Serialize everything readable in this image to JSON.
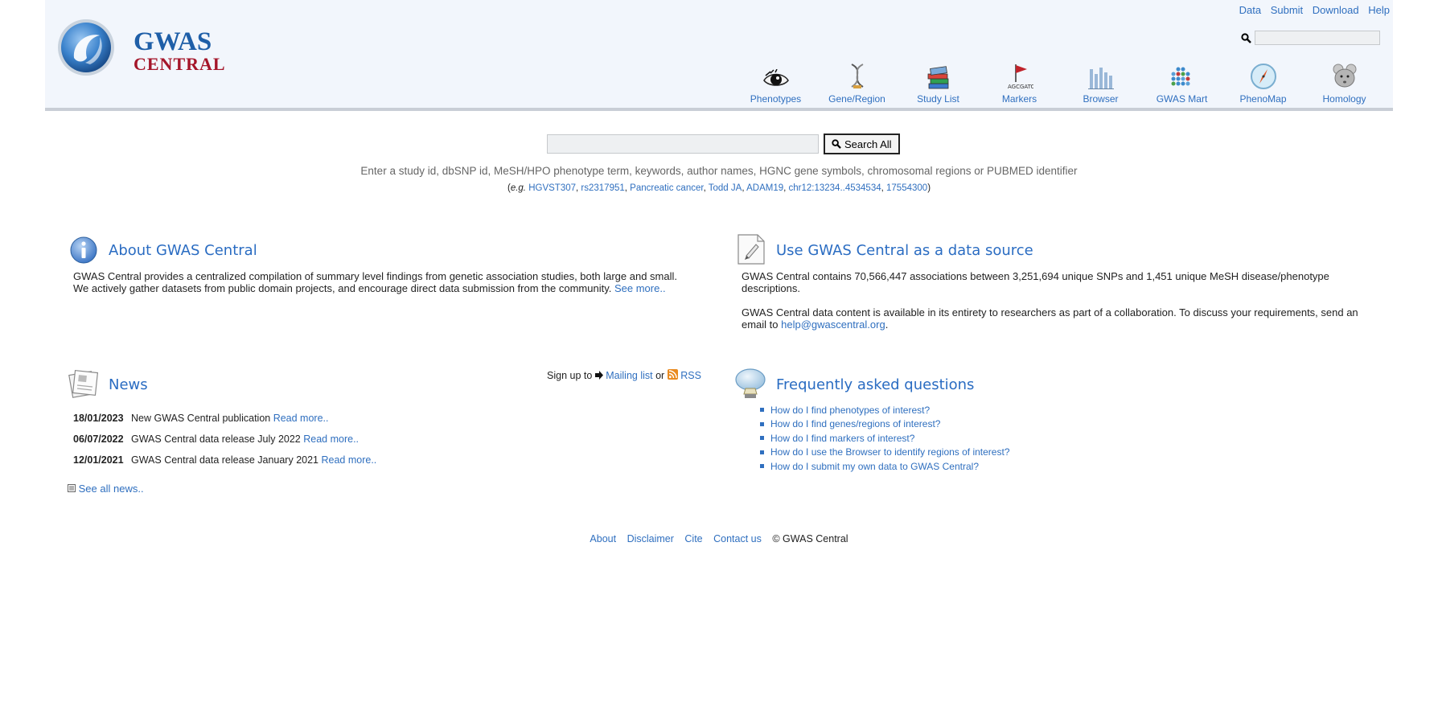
{
  "header": {
    "logo_line1": "GWAS",
    "logo_line2": "CENTRAL",
    "toplinks": [
      "Data",
      "Submit",
      "Download",
      "Help"
    ],
    "search_placeholder": "",
    "nav": [
      {
        "label": "Phenotypes",
        "icon": "eye-icon"
      },
      {
        "label": "Gene/Region",
        "icon": "dna-icon"
      },
      {
        "label": "Study List",
        "icon": "books-icon"
      },
      {
        "label": "Markers",
        "icon": "flag-icon"
      },
      {
        "label": "Browser",
        "icon": "browser-bars-icon"
      },
      {
        "label": "GWAS Mart",
        "icon": "dots-grid-icon"
      },
      {
        "label": "PhenoMap",
        "icon": "compass-icon"
      },
      {
        "label": "Homology",
        "icon": "mouse-icon"
      }
    ]
  },
  "search": {
    "button_label": "Search All",
    "hint": "Enter a study id, dbSNP id, MeSH/HPO phenotype term, keywords, author names, HGNC gene symbols, chromosomal regions or PUBMED identifier",
    "examples_prefix": "(",
    "examples_eg": "e.g.",
    "examples": [
      "HGVST307",
      "rs2317951",
      "Pancreatic cancer",
      "Todd JA",
      "ADAM19",
      "chr12:13234..4534534",
      "17554300"
    ],
    "examples_suffix": ")"
  },
  "about": {
    "title": "About GWAS Central",
    "line1": "GWAS Central provides a centralized compilation of summary level findings from genetic association studies, both large and small.",
    "line2": "We actively gather datasets from public domain projects, and encourage direct data submission from the community.",
    "see_more": "See more.."
  },
  "datasource": {
    "title": "Use GWAS Central as a data source",
    "para1": "GWAS Central contains 70,566,447 associations between 3,251,694 unique SNPs and 1,451 unique MeSH disease/phenotype descriptions.",
    "para2_text": "GWAS Central data content is available in its entirety to researchers as part of a collaboration. To discuss your requirements, send an email to",
    "email": "help@gwascentral.org",
    "para2_end": "."
  },
  "news": {
    "title": "News",
    "signup_text": "Sign up to",
    "mailing_list": "Mailing list",
    "or_text": "or",
    "rss": "RSS",
    "items": [
      {
        "date": "18/01/2023",
        "text": "New GWAS Central publication",
        "link": "Read more.."
      },
      {
        "date": "06/07/2022",
        "text": "GWAS Central data release July 2022",
        "link": "Read more.."
      },
      {
        "date": "12/01/2021",
        "text": "GWAS Central data release January 2021",
        "link": "Read more.."
      }
    ],
    "see_all": "See all news.."
  },
  "faq": {
    "title": "Frequently asked questions",
    "items": [
      "How do I find phenotypes of interest?",
      "How do I find genes/regions of interest?",
      "How do I find markers of interest?",
      "How do I use the Browser to identify regions of interest?",
      "How do I submit my own data to GWAS Central?"
    ]
  },
  "footer": {
    "links": [
      "About",
      "Disclaimer",
      "Cite",
      "Contact us"
    ],
    "copyright": "© GWAS Central"
  },
  "colors": {
    "accent": "#2f6fbf",
    "title": "#2a6cc2",
    "header_bg": "#f2f6fc",
    "logo_red": "#a4162a"
  }
}
